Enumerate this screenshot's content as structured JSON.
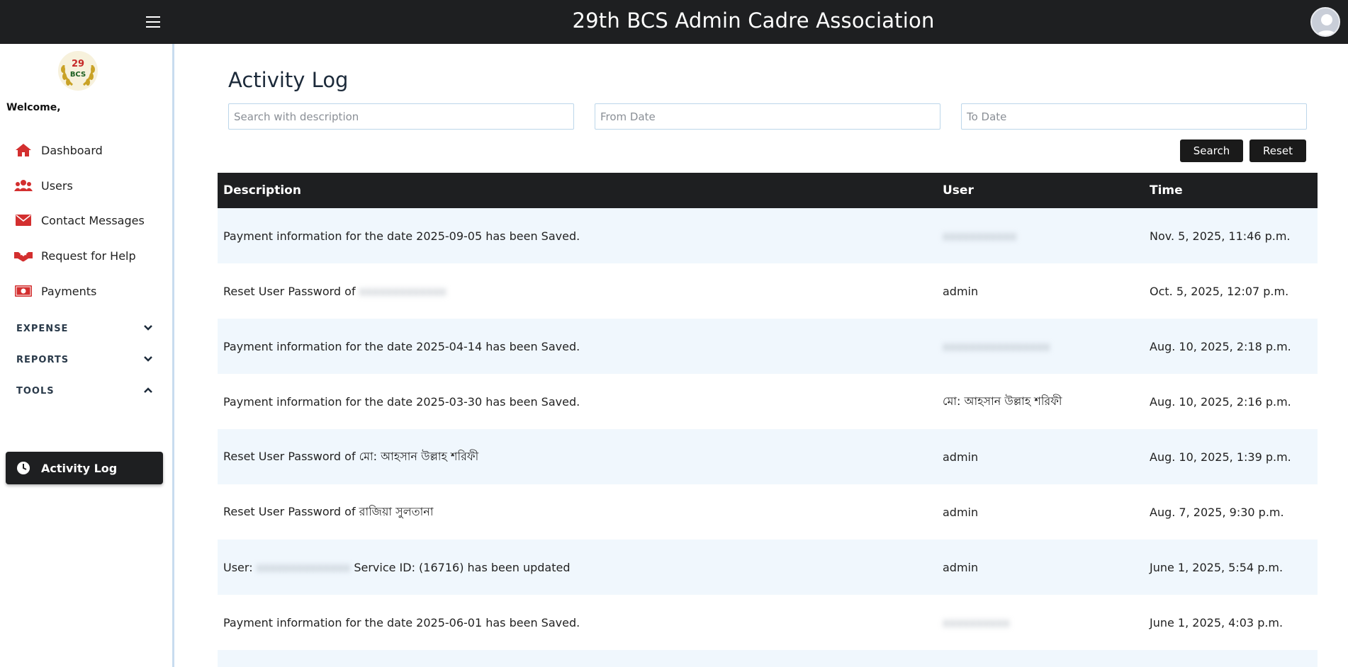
{
  "app": {
    "title": "29th BCS Admin Cadre Association"
  },
  "sidebar": {
    "logo_text": "BCS",
    "logo_number": "29",
    "welcome": "Welcome,",
    "items": [
      {
        "label": "Dashboard",
        "icon": "home-icon"
      },
      {
        "label": "Users",
        "icon": "users-icon"
      },
      {
        "label": "Contact Messages",
        "icon": "envelope-icon"
      },
      {
        "label": "Request for Help",
        "icon": "handshake-icon"
      },
      {
        "label": "Payments",
        "icon": "money-icon"
      }
    ],
    "sections": [
      {
        "label": "EXPENSE",
        "expanded": false
      },
      {
        "label": "REPORTS",
        "expanded": false
      },
      {
        "label": "TOOLS",
        "expanded": true
      }
    ],
    "active_item": {
      "label": "Activity Log",
      "icon": "clock-icon"
    }
  },
  "page": {
    "title": "Activity Log",
    "search_placeholder": "Search with description",
    "from_placeholder": "From Date",
    "to_placeholder": "To Date",
    "search_button": "Search",
    "reset_button": "Reset"
  },
  "table": {
    "headers": [
      "Description",
      "User",
      "Time"
    ],
    "rows": [
      {
        "description": "Payment information for the date 2025-09-05 has been Saved.",
        "user": "",
        "time": "Nov. 5, 2025, 11:46 p.m."
      },
      {
        "description": "Reset User Password of ",
        "user": "admin",
        "time": "Oct. 5, 2025, 12:07 p.m."
      },
      {
        "description": "Payment information for the date 2025-04-14 has been Saved.",
        "user": "",
        "time": "Aug. 10, 2025, 2:18 p.m."
      },
      {
        "description": "Payment information for the date 2025-03-30 has been Saved.",
        "user": "মো: আহসান উল্লাহ শরিফী",
        "time": "Aug. 10, 2025, 2:16 p.m."
      },
      {
        "description": "Reset User Password of মো: আহসান উল্লাহ শরিফী",
        "user": "admin",
        "time": "Aug. 10, 2025, 1:39 p.m."
      },
      {
        "description": "Reset User Password of রাজিয়া সুলতানা",
        "user": "admin",
        "time": "Aug. 7, 2025, 9:30 p.m."
      },
      {
        "description": "User: ",
        "description_suffix": " Service ID: (16716) has been updated",
        "user": "admin",
        "time": "June 1, 2025, 5:54 p.m."
      },
      {
        "description": "Payment information for the date 2025-06-01 has been Saved.",
        "user": "",
        "time": "June 1, 2025, 4:03 p.m."
      }
    ]
  },
  "colors": {
    "topbar": "#1e1f21",
    "accent_red": "#d32f2f",
    "row_alt": "#f0f7fd"
  }
}
